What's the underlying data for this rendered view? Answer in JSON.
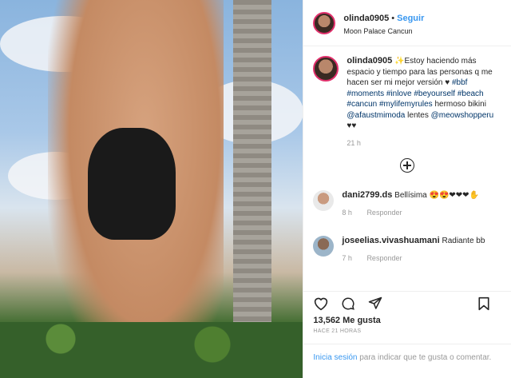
{
  "post": {
    "username": "olinda0905",
    "follow_label": "Seguir",
    "separator": "•",
    "location": "Moon Palace Cancun",
    "caption": {
      "username": "olinda0905",
      "text": "✨Estoy haciendo más espacio y tiempo para las personas q me hacen ser mi mejor versión ♥",
      "hashtags": "#bbf #moments #inlove #beyourself #beach #cancun #mylifemyrules",
      "bikini_text": "hermoso bikini",
      "bikini_tag": "@afaustmimoda",
      "lentes_text": "lentes",
      "lentes_tag": "@meowshopperu",
      "hearts": "♥♥",
      "time": "21 h"
    },
    "comments": [
      {
        "username": "dani2799.ds",
        "text": "Bellísima 😍😍❤❤❤✋",
        "time": "8 h",
        "reply": "Responder"
      },
      {
        "username": "joseelias.vivashuamani",
        "text": "Radiante bb",
        "time": "7 h",
        "reply": "Responder"
      }
    ],
    "likes": "13,562 Me gusta",
    "posted_ago": "HACE 21 HORAS",
    "login": {
      "link": "Inicia sesión",
      "text": " para indicar que te gusta o comentar."
    }
  }
}
